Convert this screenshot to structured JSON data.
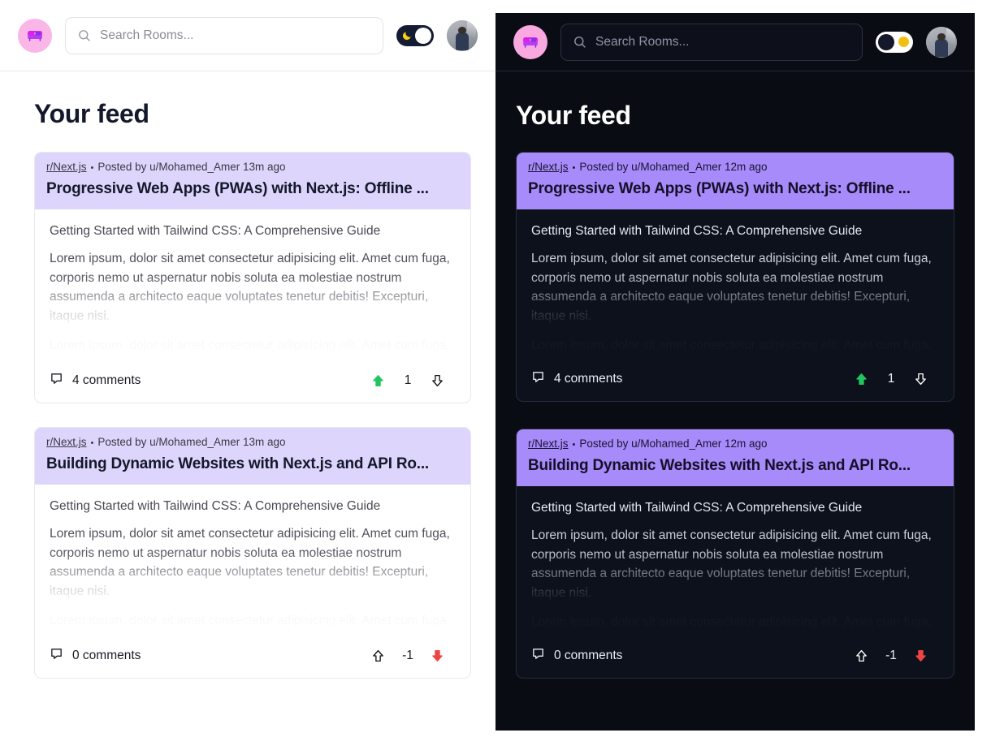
{
  "colors": {
    "accent_purple": "#a78bfa",
    "header_light": "#ddd5fb",
    "logo_bg": "#fbb6e8",
    "upvote_green": "#22c55e",
    "downvote_red": "#ef4444",
    "dark_bg": "#0a0c14",
    "dark_card": "#0d111b",
    "sun_yellow": "#f2c014",
    "moon_yellow": "#facc15"
  },
  "light_panel": {
    "header": {
      "logo_icon": "couch-icon",
      "search": {
        "placeholder": "Search Rooms...",
        "value": "",
        "icon": "search-icon"
      },
      "theme_toggle": {
        "state": "off",
        "glyph": "moon-icon"
      },
      "avatar_alt": "user-avatar"
    },
    "feed_title": "Your feed",
    "posts": [
      {
        "subreddit": "r/Next.js",
        "separator": "•",
        "posted_by": "Posted by u/Mohamed_Amer 13m ago",
        "title": "Progressive Web Apps (PWAs) with Next.js: Offline ...",
        "body_heading": "Getting Started with Tailwind CSS: A Comprehensive Guide",
        "body_p1": "Lorem ipsum, dolor sit amet consectetur adipisicing elit. Amet cum fuga, corporis nemo ut aspernatur nobis soluta ea molestiae nostrum assumenda a architecto eaque voluptates tenetur debitis! Excepturi, itaque nisi.",
        "body_p2": "Lorem ipsum, dolor sit amet consectetur adipisicing elit. Amet cum fuga, corporis nemo ut aspernatur nobis soluta ea molestiae nostrum assumenda a architecto eaque voluptates tenetur debitis! Excepturi, itaque nisi.",
        "comments_label": "4 comments",
        "score": "1",
        "upvote_state": "active",
        "downvote_state": "inactive"
      },
      {
        "subreddit": "r/Next.js",
        "separator": "•",
        "posted_by": "Posted by u/Mohamed_Amer 13m ago",
        "title": "Building Dynamic Websites with Next.js and API Ro...",
        "body_heading": "Getting Started with Tailwind CSS: A Comprehensive Guide",
        "body_p1": "Lorem ipsum, dolor sit amet consectetur adipisicing elit. Amet cum fuga, corporis nemo ut aspernatur nobis soluta ea molestiae nostrum assumenda a architecto eaque voluptates tenetur debitis! Excepturi, itaque nisi.",
        "body_p2": "Lorem ipsum, dolor sit amet consectetur adipisicing elit. Amet cum fuga, corporis nemo ut aspernatur nobis soluta ea molestiae nostrum assumenda a architecto eaque voluptates tenetur debitis! Excepturi, itaque nisi.",
        "comments_label": "0 comments",
        "score": "-1",
        "upvote_state": "inactive",
        "downvote_state": "active"
      }
    ]
  },
  "dark_panel": {
    "header": {
      "logo_icon": "couch-icon",
      "search": {
        "placeholder": "Search Rooms...",
        "value": "",
        "icon": "search-icon"
      },
      "theme_toggle": {
        "state": "on",
        "glyph": "sun-icon"
      },
      "avatar_alt": "user-avatar"
    },
    "feed_title": "Your feed",
    "posts": [
      {
        "subreddit": "r/Next.js",
        "separator": "•",
        "posted_by": "Posted by u/Mohamed_Amer 12m ago",
        "title": "Progressive Web Apps (PWAs) with Next.js: Offline ...",
        "body_heading": "Getting Started with Tailwind CSS: A Comprehensive Guide",
        "body_p1": "Lorem ipsum, dolor sit amet consectetur adipisicing elit. Amet cum fuga, corporis nemo ut aspernatur nobis soluta ea molestiae nostrum assumenda a architecto eaque voluptates tenetur debitis! Excepturi, itaque nisi.",
        "body_p2": "Lorem ipsum, dolor sit amet consectetur adipisicing elit. Amet cum fuga, corporis nemo ut aspernatur nobis soluta ea molestiae nostrum assumenda a architecto eaque voluptates tenetur debitis! Excepturi, itaque nisi.",
        "comments_label": "4 comments",
        "score": "1",
        "upvote_state": "active",
        "downvote_state": "inactive"
      },
      {
        "subreddit": "r/Next.js",
        "separator": "•",
        "posted_by": "Posted by u/Mohamed_Amer 12m ago",
        "title": "Building Dynamic Websites with Next.js and API Ro...",
        "body_heading": "Getting Started with Tailwind CSS: A Comprehensive Guide",
        "body_p1": "Lorem ipsum, dolor sit amet consectetur adipisicing elit. Amet cum fuga, corporis nemo ut aspernatur nobis soluta ea molestiae nostrum assumenda a architecto eaque voluptates tenetur debitis! Excepturi, itaque nisi.",
        "body_p2": "Lorem ipsum, dolor sit amet consectetur adipisicing elit. Amet cum fuga, corporis nemo ut aspernatur nobis soluta ea molestiae nostrum assumenda a architecto eaque voluptates tenetur debitis! Excepturi, itaque nisi.",
        "comments_label": "0 comments",
        "score": "-1",
        "upvote_state": "inactive",
        "downvote_state": "active"
      }
    ]
  }
}
